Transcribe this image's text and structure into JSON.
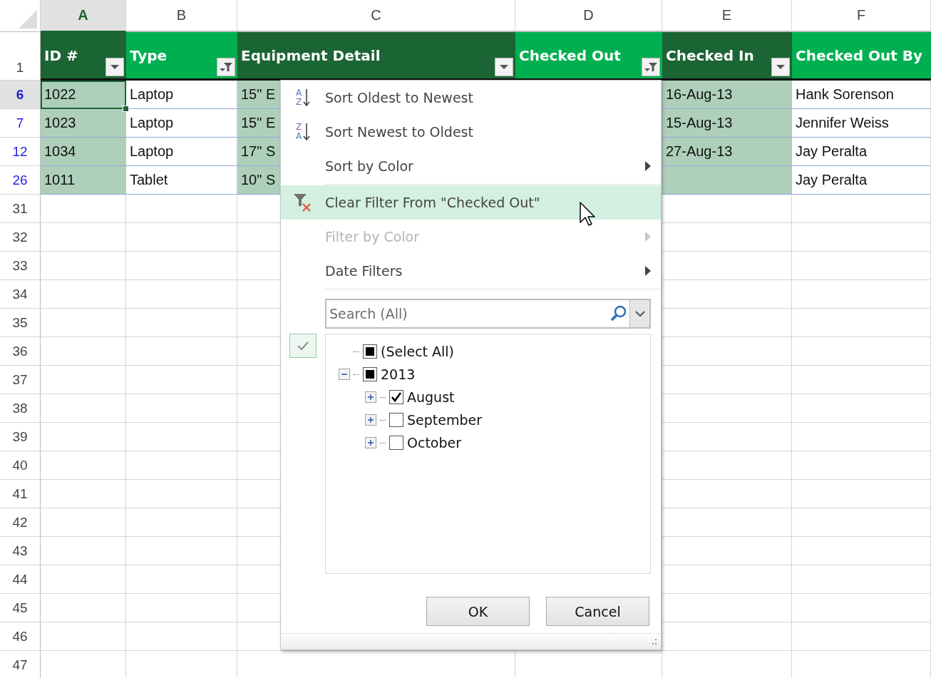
{
  "columns": [
    {
      "letter": "A",
      "selected": true,
      "header": "ID #",
      "color": "#1b6534",
      "filtered": false,
      "shaded": true
    },
    {
      "letter": "B",
      "selected": false,
      "header": "Type",
      "color": "#00b050",
      "filtered": true,
      "shaded": false
    },
    {
      "letter": "C",
      "selected": false,
      "header": "Equipment Detail",
      "color": "#1b6534",
      "filtered": false,
      "shaded": true
    },
    {
      "letter": "D",
      "selected": false,
      "header": "Checked Out",
      "color": "#00b050",
      "filtered": true,
      "shaded": false
    },
    {
      "letter": "E",
      "selected": false,
      "header": "Checked In",
      "color": "#1b6534",
      "filtered": false,
      "shaded": true
    },
    {
      "letter": "F",
      "selected": false,
      "header": "Checked Out By",
      "color": "#00b050",
      "shaded": false
    }
  ],
  "header_row": "1",
  "rows": [
    {
      "number": "6",
      "selected": true,
      "cells": {
        "A": "1022",
        "B": "Laptop",
        "C": "15\" E",
        "E": "16-Aug-13",
        "F": "Hank Sorenson"
      }
    },
    {
      "number": "7",
      "selected": false,
      "cells": {
        "A": "1023",
        "B": "Laptop",
        "C": "15\" E",
        "E": "15-Aug-13",
        "F": "Jennifer Weiss"
      }
    },
    {
      "number": "12",
      "selected": false,
      "cells": {
        "A": "1034",
        "B": "Laptop",
        "C": "17\" S",
        "E": "27-Aug-13",
        "F": "Jay Peralta"
      }
    },
    {
      "number": "26",
      "selected": false,
      "cells": {
        "A": "1011",
        "B": "Tablet",
        "C": "10\" S",
        "F": "Jay Peralta"
      }
    }
  ],
  "empty_rows": [
    "31",
    "32",
    "33",
    "34",
    "35",
    "36",
    "37",
    "38",
    "39",
    "40",
    "41",
    "42",
    "43",
    "44",
    "45",
    "46",
    "47"
  ],
  "filter_menu": {
    "items": [
      {
        "kind": "sort",
        "label": "Sort Oldest to Newest",
        "icon_letters": [
          "A",
          "Z"
        ],
        "disabled": false,
        "highlighted": false
      },
      {
        "kind": "sort",
        "label": "Sort Newest to Oldest",
        "icon_letters": [
          "Z",
          "A"
        ],
        "disabled": false,
        "highlighted": false
      },
      {
        "kind": "submenu",
        "label": "Sort by Color",
        "disabled": false,
        "highlighted": false
      },
      {
        "kind": "separator"
      },
      {
        "kind": "clear",
        "label": "Clear Filter From \"Checked Out\"",
        "disabled": false,
        "highlighted": true
      },
      {
        "kind": "submenu",
        "label": "Filter by Color",
        "disabled": true,
        "highlighted": false
      },
      {
        "kind": "submenu",
        "label": "Date Filters",
        "disabled": false,
        "highlighted": false
      },
      {
        "kind": "separator"
      }
    ],
    "search": {
      "placeholder": "Search (All)"
    },
    "tree": [
      {
        "label": "(Select All)",
        "checked": false,
        "partial": true
      },
      {
        "label": "2013",
        "checked": false,
        "partial": true,
        "expanded": true,
        "children": [
          {
            "label": "August",
            "checked": true,
            "partial": false,
            "expanded": false
          },
          {
            "label": "September",
            "checked": false,
            "partial": false,
            "expanded": false
          },
          {
            "label": "October",
            "checked": false,
            "partial": false,
            "expanded": false
          }
        ]
      }
    ],
    "buttons": [
      "OK",
      "Cancel"
    ]
  }
}
